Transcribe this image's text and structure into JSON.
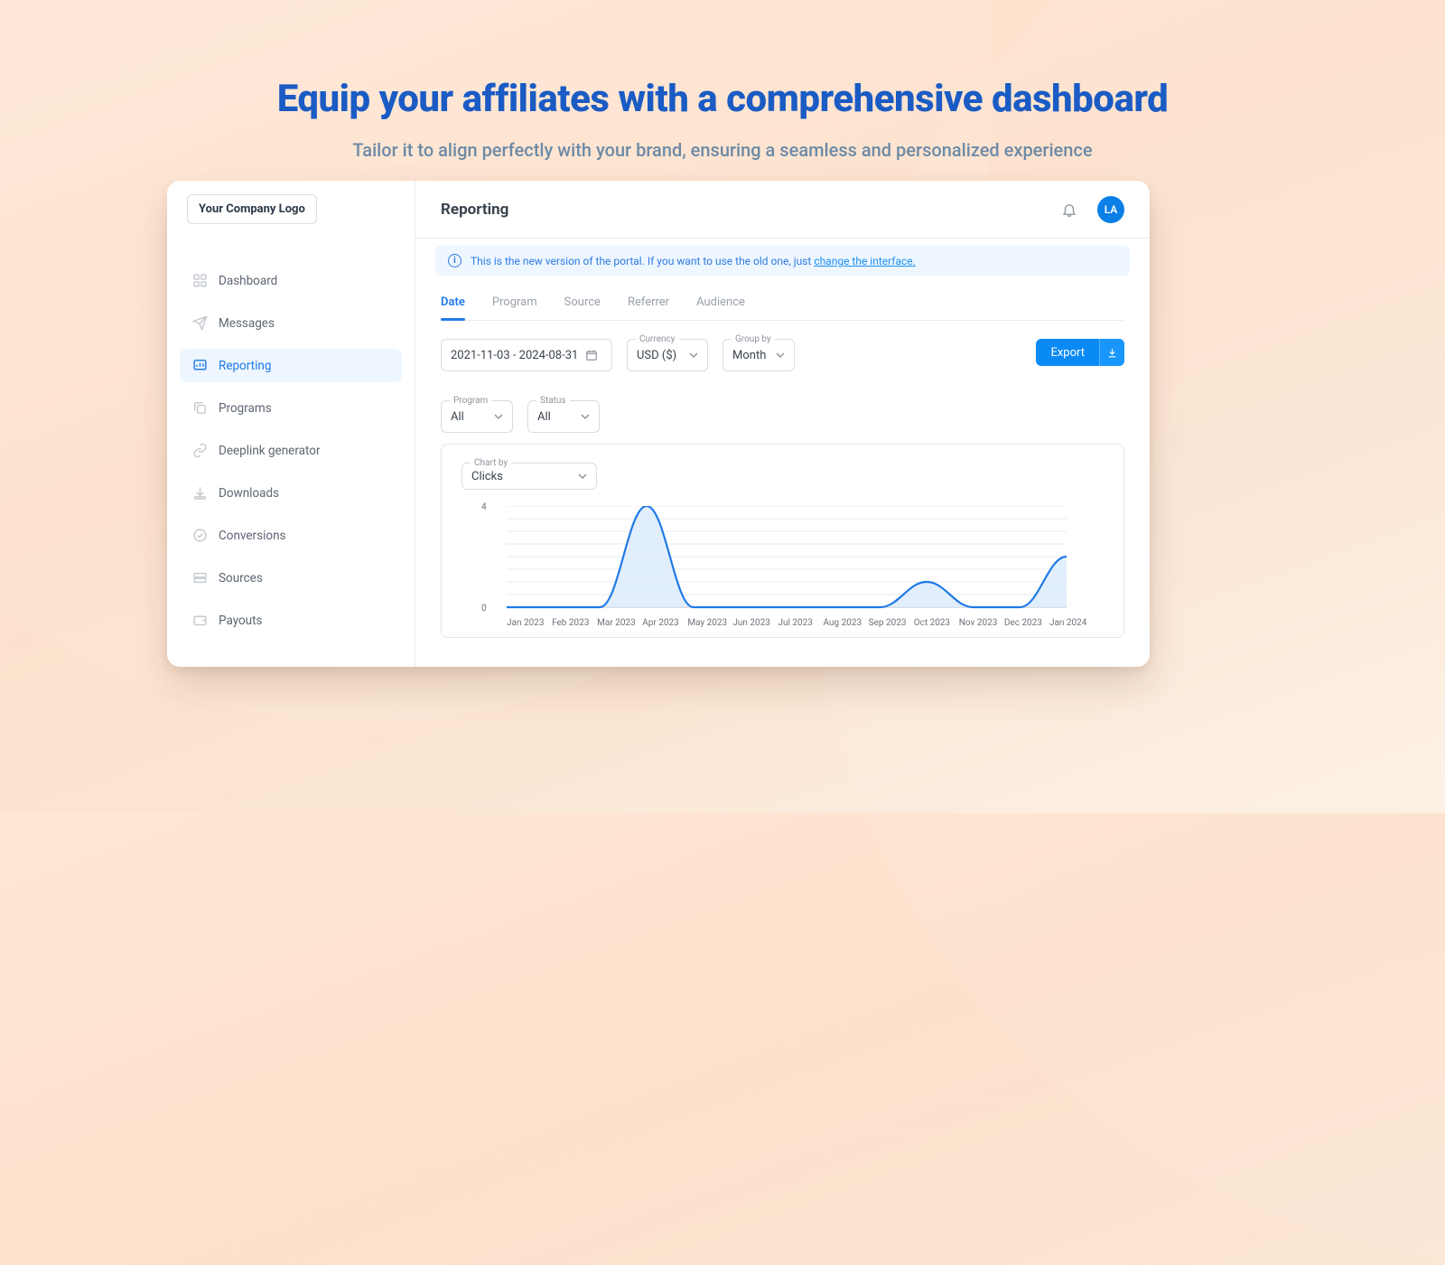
{
  "hero": {
    "title": "Equip your affiliates with  a comprehensive dashboard",
    "subtitle": "Tailor it to align perfectly with your brand, ensuring a seamless and personalized experience"
  },
  "sidebar": {
    "logo_text": "Your Company Logo",
    "items": [
      {
        "label": "Dashboard",
        "icon": "grid"
      },
      {
        "label": "Messages",
        "icon": "send"
      },
      {
        "label": "Reporting",
        "icon": "chart",
        "active": true
      },
      {
        "label": "Programs",
        "icon": "copy"
      },
      {
        "label": "Deeplink generator",
        "icon": "link"
      },
      {
        "label": "Downloads",
        "icon": "download"
      },
      {
        "label": "Conversions",
        "icon": "target"
      },
      {
        "label": "Sources",
        "icon": "sources"
      },
      {
        "label": "Payouts",
        "icon": "wallet"
      }
    ]
  },
  "topbar": {
    "title": "Reporting",
    "avatar_initials": "LA"
  },
  "banner": {
    "text": "This is the new version of the portal. If you want to use the old one, just ",
    "link_text": "change the interface."
  },
  "tabs": {
    "items": [
      "Date",
      "Program",
      "Source",
      "Referrer",
      "Audience"
    ],
    "active_index": 0
  },
  "filters": {
    "date_range": "2021-11-03 - 2024-08-31",
    "currency_label": "Currency",
    "currency_value": "USD ($)",
    "groupby_label": "Group by",
    "groupby_value": "Month",
    "program_label": "Program",
    "program_value": "All",
    "status_label": "Status",
    "status_value": "All",
    "export_label": "Export"
  },
  "chart": {
    "chartby_label": "Chart by",
    "chartby_value": "Clicks"
  },
  "chart_data": {
    "type": "area",
    "title": "",
    "xlabel": "",
    "ylabel": "",
    "ylim": [
      0,
      4
    ],
    "yticks": [
      0,
      4
    ],
    "categories": [
      "Jan 2023",
      "Feb 2023",
      "Mar 2023",
      "Apr 2023",
      "May 2023",
      "Jun 2023",
      "Jul 2023",
      "Aug 2023",
      "Sep 2023",
      "Oct 2023",
      "Nov 2023",
      "Dec 2023",
      "Jan 2024"
    ],
    "series": [
      {
        "name": "Clicks",
        "values": [
          0,
          0,
          0,
          4,
          0,
          0,
          0,
          0,
          0,
          1,
          0,
          0,
          2
        ]
      }
    ]
  },
  "colors": {
    "accent": "#0a8af5",
    "accent_dark": "#1a5bc4"
  }
}
